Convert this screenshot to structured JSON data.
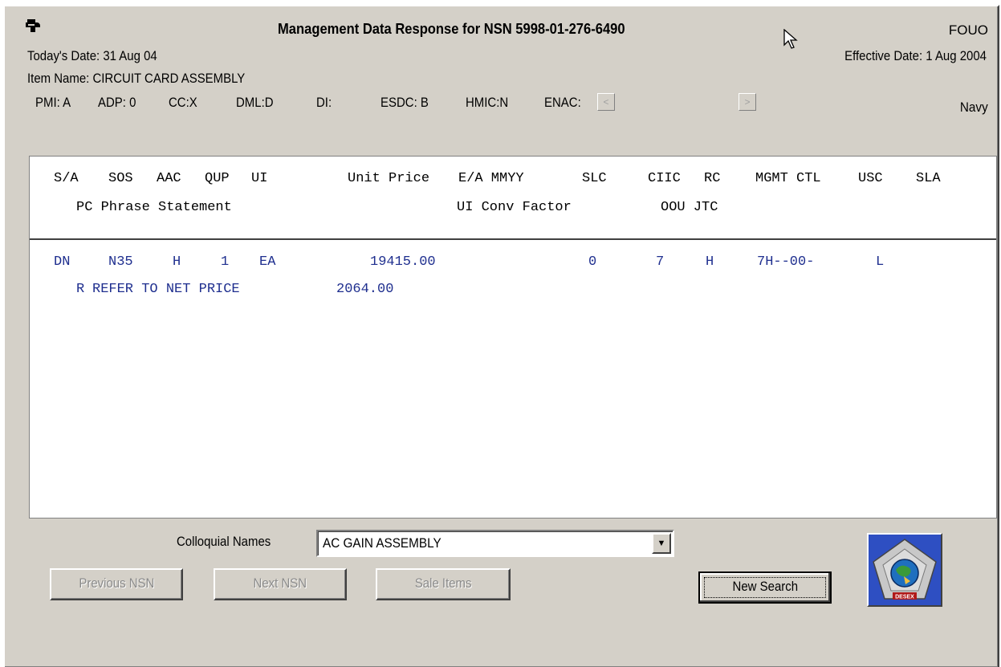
{
  "window": {
    "title": "Management Data Response for NSN 5998-01-276-6490",
    "classification": "FOUO",
    "today_date": "Today's Date: 31 Aug 04",
    "effective_date": "Effective Date: 1 Aug 2004",
    "item_name": "Item Name: CIRCUIT CARD ASSEMBLY",
    "service": "Navy"
  },
  "meta": {
    "pmi": "PMI: A",
    "adp": "ADP: 0",
    "cc": "CC:X",
    "dml": "DML:D",
    "di": "DI:",
    "esdc": "ESDC: B",
    "hmic": "HMIC:N",
    "enac": "ENAC:"
  },
  "nav_arrows": {
    "prev": "<",
    "next": ">"
  },
  "header": {
    "row1": [
      "S/A",
      "SOS",
      "AAC",
      "QUP",
      "UI",
      "Unit Price",
      "E/A MMYY",
      "SLC",
      "CIIC",
      "RC",
      "MGMT CTL",
      "USC",
      "SLA"
    ],
    "row2": [
      "PC Phrase Statement",
      "UI Conv Factor",
      "OOU JTC"
    ]
  },
  "record": {
    "sa": "DN",
    "sos": "N35",
    "aac": "H",
    "qup": "1",
    "ui": "EA",
    "unit_price": "19415.00",
    "slc": "0",
    "ciic": "7",
    "rc": "H",
    "mgmt_ctl": "7H--00-",
    "usc": "L",
    "pc": "R",
    "phrase": "REFER TO NET PRICE",
    "conv_factor": "2064.00"
  },
  "colloquial": {
    "label": "Colloquial Names",
    "selected": "AC GAIN ASSEMBLY"
  },
  "buttons": {
    "previous": "Previous NSN",
    "next": "Next NSN",
    "sale": "Sale Items",
    "new_search": "New Search"
  },
  "logo_text": "DESEX",
  "icons": [
    "app-hand-icon",
    "cursor-arrow-icon",
    "scroll-left-icon",
    "scroll-right-icon",
    "dropdown-arrow-icon",
    "desex-logo-icon"
  ]
}
